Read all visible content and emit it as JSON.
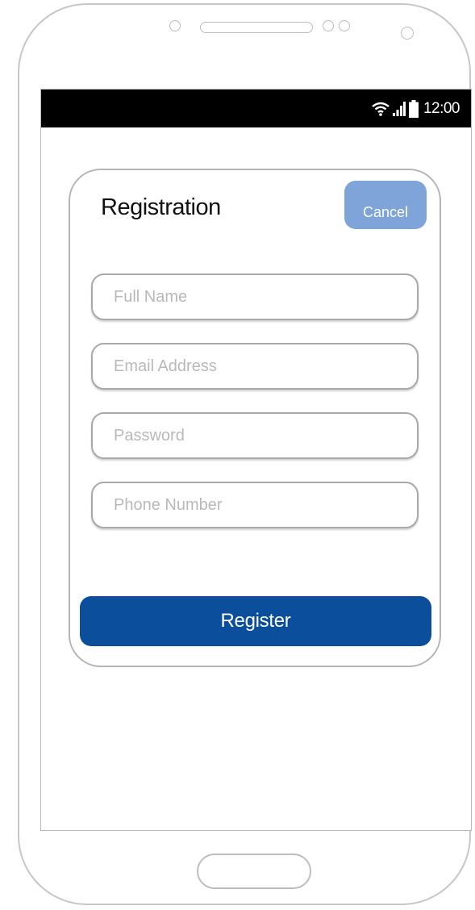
{
  "status_bar": {
    "time": "12:00",
    "icons": [
      "wifi-icon",
      "signal-icon",
      "battery-icon"
    ]
  },
  "registration": {
    "title": "Registration",
    "cancel_label": "Cancel",
    "fields": {
      "full_name_placeholder": "Full Name",
      "email_placeholder": "Email Address",
      "password_placeholder": "Password",
      "phone_placeholder": "Phone Number"
    },
    "register_label": "Register"
  },
  "colors": {
    "status_bar": "#000000",
    "cancel_button": "#7ea4d9",
    "register_button": "#0b4f9c",
    "frame_stroke": "#c7c7c7"
  }
}
